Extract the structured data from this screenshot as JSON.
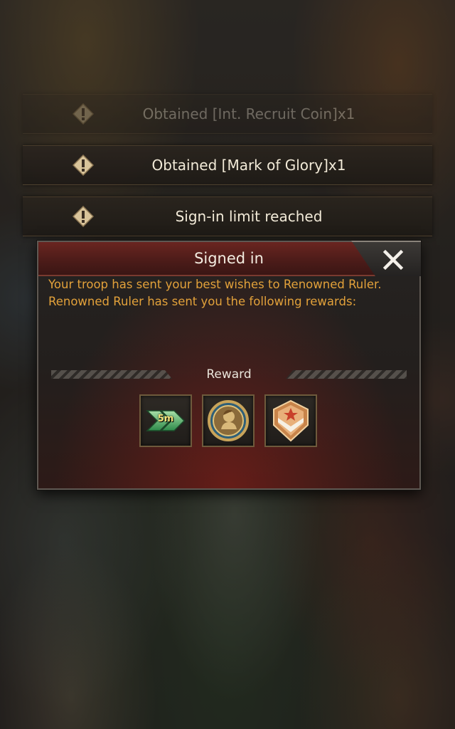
{
  "notifications": [
    {
      "text": "Obtained [Int. Recruit Coin]x1",
      "icon": "warning-icon",
      "faded": true
    },
    {
      "text": "Obtained [Mark of Glory]x1",
      "icon": "warning-icon",
      "faded": false
    },
    {
      "text": "Sign-in limit reached",
      "icon": "warning-icon",
      "faded": false
    }
  ],
  "dialog": {
    "title": "Signed in",
    "close_icon": "close-icon",
    "message_line1": "Your troop has sent your best wishes to Renowned Ruler.",
    "message_line2": "Renowned Ruler has sent you the following rewards:",
    "reward_label": "Reward",
    "rewards": [
      {
        "icon": "speedup-arrows-icon",
        "qty": "5m"
      },
      {
        "icon": "recruit-coin-icon"
      },
      {
        "icon": "mark-of-glory-icon"
      }
    ]
  },
  "colors": {
    "message_text": "#e2a13a",
    "title_bar": "#4d1c19",
    "toast_text": "#f2ead8"
  }
}
